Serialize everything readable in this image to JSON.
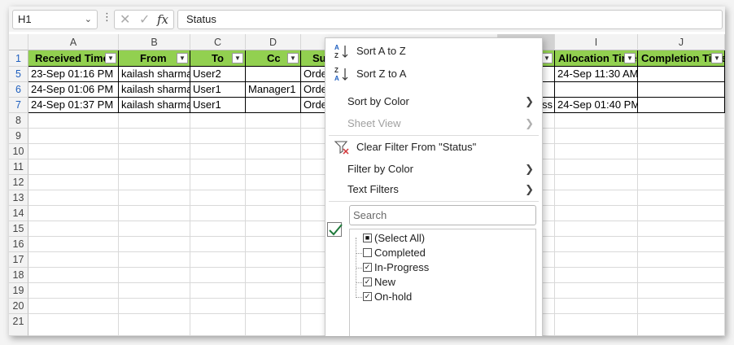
{
  "formula_bar": {
    "name_box": "H1",
    "cancel_icon": "x-icon",
    "enter_icon": "check-icon",
    "fx_label": "fx",
    "content": "Status"
  },
  "columns": [
    "A",
    "B",
    "C",
    "D",
    "",
    "I",
    "J"
  ],
  "rows": [
    "1",
    "5",
    "6",
    "7",
    "8",
    "9",
    "10",
    "11",
    "12",
    "13",
    "14",
    "15",
    "16",
    "17",
    "18",
    "19",
    "20",
    "21"
  ],
  "headers": {
    "a": "Received Time",
    "b": "From",
    "c": "To",
    "d": "Cc",
    "e": "Subject",
    "i": "Allocation Time",
    "j": "Completion Time"
  },
  "data_rows": [
    {
      "a": "23-Sep 01:16 PM",
      "b": "kailash sharma",
      "c": "User2",
      "d": "",
      "e": "Order",
      "h": "",
      "i": "24-Sep 11:30 AM"
    },
    {
      "a": "24-Sep 01:06 PM",
      "b": "kailash sharma",
      "c": "User1",
      "d": "Manager1",
      "e": "Order",
      "h": "",
      "i": ""
    },
    {
      "a": "24-Sep 01:37 PM",
      "b": "kailash sharma",
      "c": "User1",
      "d": "",
      "e": "Order",
      "h": "ss",
      "i": "24-Sep 01:40 PM"
    }
  ],
  "menu": {
    "sort_az": "Sort A to Z",
    "sort_za": "Sort Z to A",
    "sort_by_color": "Sort by Color",
    "sheet_view": "Sheet View",
    "clear_filter": "Clear Filter From \"Status\"",
    "filter_by_color": "Filter by Color",
    "text_filters": "Text Filters",
    "search_placeholder": "Search",
    "items": [
      {
        "label": "(Select All)",
        "state": "partial"
      },
      {
        "label": "Completed",
        "state": "unchecked"
      },
      {
        "label": "In-Progress",
        "state": "checked"
      },
      {
        "label": "New",
        "state": "checked"
      },
      {
        "label": "On-hold",
        "state": "checked"
      }
    ]
  },
  "colors": {
    "header_fill": "#92d050",
    "check_green": "#1e7a3a",
    "clear_filter_red": "#d13438"
  }
}
